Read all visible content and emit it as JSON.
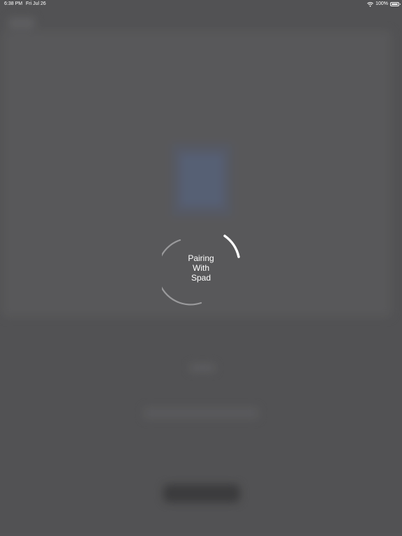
{
  "status_bar": {
    "time": "6:38 PM",
    "date": "Fri Jul 26",
    "battery_percent": "100%",
    "battery_level": 1.0,
    "wifi_icon": "wifi-icon",
    "battery_icon": "battery-icon"
  },
  "loading": {
    "line1": "Pairing",
    "line2": "With",
    "line3": "Spad",
    "indicator_icon": "spinner-icon"
  },
  "colors": {
    "background": "#5a5a5c",
    "spinner_track": "#9a9a9c",
    "spinner_active": "#ffffff",
    "text": "#ffffff"
  }
}
